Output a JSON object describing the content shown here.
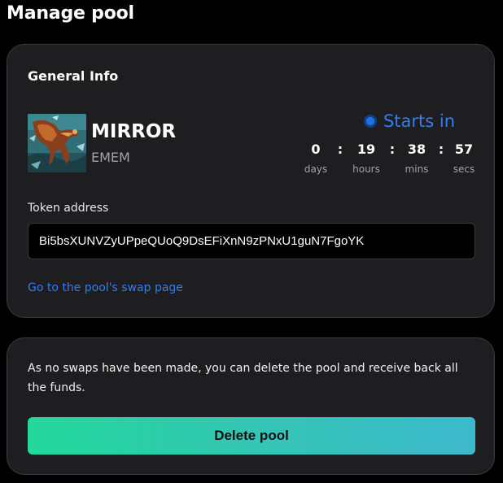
{
  "page": {
    "title": "Manage pool"
  },
  "general_info": {
    "title": "General Info",
    "token": {
      "name": "MIRROR",
      "symbol": "EMEM",
      "image_icon": "token-artwork-image"
    },
    "status": {
      "text": "Starts in",
      "color": "#2f7ff2"
    },
    "countdown": [
      {
        "value": "0",
        "label": "days"
      },
      {
        "value": "19",
        "label": "hours"
      },
      {
        "value": "38",
        "label": "mins"
      },
      {
        "value": "57",
        "label": "secs"
      }
    ],
    "separator": ":",
    "address_label": "Token address",
    "address_value": "Bi5bsXUNVZyUPpeQUoQ9DsEFiXnN9zPNxU1guN7FgoYK",
    "swap_link": "Go to the pool's swap page"
  },
  "delete_section": {
    "message": "As no swaps have been made, you can delete the pool and receive back all the funds.",
    "button_label": "Delete pool",
    "button_gradient": [
      "#22d89a",
      "#3cb8cc"
    ]
  }
}
